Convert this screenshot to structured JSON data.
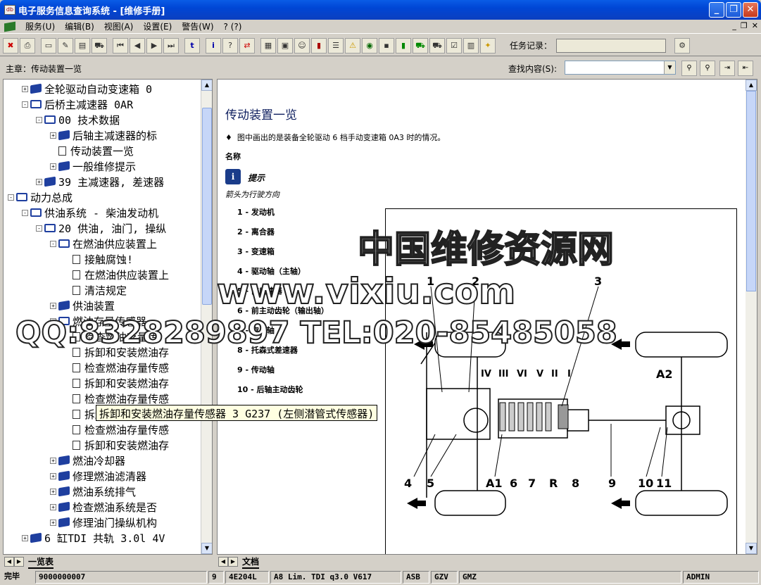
{
  "window": {
    "title": "电子服务信息查询系统 - [维修手册]",
    "buttons": [
      "_",
      "❐",
      "✕"
    ]
  },
  "menu": {
    "items": [
      "服务(U)",
      "编辑(B)",
      "视图(A)",
      "设置(E)",
      "警告(W)",
      "? (?)"
    ],
    "mdi": [
      "_",
      "❐",
      "✕"
    ]
  },
  "toolbar": {
    "task_label": "任务记录："
  },
  "searchbar": {
    "chapter": "主章：传动装置一览",
    "find_label": "查找内容(S):",
    "find_value": ""
  },
  "tree": {
    "items": [
      {
        "label": "全轮驱动自动变速箱 0",
        "level": 2,
        "icon": "closed",
        "exp": "+"
      },
      {
        "label": "后桥主减速器 0AR",
        "level": 2,
        "icon": "open",
        "exp": "-"
      },
      {
        "label": "00 技术数据",
        "level": 3,
        "icon": "open",
        "exp": "-"
      },
      {
        "label": "后轴主减速器的标",
        "level": 4,
        "icon": "closed",
        "exp": "+"
      },
      {
        "label": "传动装置一览",
        "level": 4,
        "icon": "doc",
        "exp": ""
      },
      {
        "label": "一般维修提示",
        "level": 4,
        "icon": "closed",
        "exp": "+"
      },
      {
        "label": "39 主减速器, 差速器",
        "level": 3,
        "icon": "closed",
        "exp": "+"
      },
      {
        "label": "动力总成",
        "level": 1,
        "icon": "open",
        "exp": "-"
      },
      {
        "label": "供油系统 - 柴油发动机",
        "level": 2,
        "icon": "open",
        "exp": "-"
      },
      {
        "label": "20 供油, 油门, 操纵",
        "level": 3,
        "icon": "open",
        "exp": "-"
      },
      {
        "label": "在燃油供应装置上",
        "level": 4,
        "icon": "open",
        "exp": "-"
      },
      {
        "label": "接触腐蚀!",
        "level": 5,
        "icon": "doc",
        "exp": ""
      },
      {
        "label": "在燃油供应装置上",
        "level": 5,
        "icon": "doc",
        "exp": ""
      },
      {
        "label": "清洁规定",
        "level": 5,
        "icon": "doc",
        "exp": ""
      },
      {
        "label": "供油装置",
        "level": 4,
        "icon": "closed",
        "exp": "+"
      },
      {
        "label": "燃油存量传感器",
        "level": 4,
        "icon": "open",
        "exp": "-"
      },
      {
        "label": "检查燃油存量传",
        "level": 5,
        "icon": "doc",
        "exp": ""
      },
      {
        "label": "拆卸和安装燃油存",
        "level": 5,
        "icon": "doc",
        "exp": ""
      },
      {
        "label": "检查燃油存量传感",
        "level": 5,
        "icon": "doc",
        "exp": ""
      },
      {
        "label": "拆卸和安装燃油存",
        "level": 5,
        "icon": "doc",
        "exp": ""
      },
      {
        "label": "检查燃油存量传感",
        "level": 5,
        "icon": "doc",
        "exp": ""
      },
      {
        "label": "拆卸和安装燃油存",
        "level": 5,
        "icon": "doc",
        "exp": ""
      },
      {
        "label": "检查燃油存量传感",
        "level": 5,
        "icon": "doc",
        "exp": ""
      },
      {
        "label": "拆卸和安装燃油存",
        "level": 5,
        "icon": "doc",
        "exp": ""
      },
      {
        "label": "燃油冷却器",
        "level": 4,
        "icon": "closed",
        "exp": "+"
      },
      {
        "label": "修理燃油滤清器",
        "level": 4,
        "icon": "closed",
        "exp": "+"
      },
      {
        "label": "燃油系统排气",
        "level": 4,
        "icon": "closed",
        "exp": "+"
      },
      {
        "label": "检查燃油系统是否",
        "level": 4,
        "icon": "closed",
        "exp": "+"
      },
      {
        "label": "修理油门操纵机构",
        "level": 4,
        "icon": "closed",
        "exp": "+"
      },
      {
        "label": "6 缸TDI 共轨 3.0l 4V",
        "level": 2,
        "icon": "closed",
        "exp": "+"
      }
    ],
    "tooltip": "拆卸和安装燃油存量传感器 3 G237 (左侧潜管式传感器)"
  },
  "doc": {
    "title": "传动装置一览",
    "note": "图中画出的是装备全轮驱动 6 档手动变速箱 0A3 时的情况。",
    "name_label": "名称",
    "hint_label": "提示",
    "hint_text": "箭头为行驶方向",
    "parts": [
      "1 - 发动机",
      "2 - 离合器",
      "3 - 变速箱",
      "4 - 驱动轴（主轴）",
      "5 - 前后速器",
      "6 - 前主动齿轮（输出轴）",
      "7 - 空心轴",
      "8 - 托森式差速器",
      "9 - 传动轴",
      "10 - 后轴主动齿轮"
    ]
  },
  "diagram": {
    "labels_top": [
      "1",
      "2",
      "3"
    ],
    "gears": [
      "IV",
      "III",
      "VI",
      "V",
      "II",
      "I"
    ],
    "labels_bottom": [
      "4",
      "5",
      "A1",
      "6",
      "7",
      "R",
      "8",
      "9",
      "10",
      "11"
    ],
    "label_a2": "A2"
  },
  "watermark": {
    "line1": "中国维修资源网",
    "line2": "www.vixiu.com",
    "line3": "QQ:8328289897 TEL:020-85485058"
  },
  "tabs": {
    "left": "一览表",
    "right": "文档"
  },
  "status": {
    "state": "完毕",
    "id": "9000000007",
    "num": "9",
    "code": "4E204L",
    "model": "A8 Lim. TDI q3.0 V617",
    "f1": "ASB",
    "f2": "GZV",
    "f3": "GMZ",
    "user": "ADMIN"
  }
}
